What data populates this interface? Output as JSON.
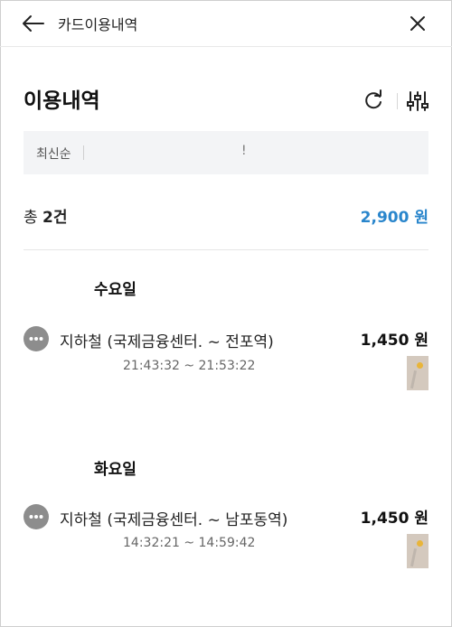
{
  "header": {
    "title": "카드이용내역",
    "back_icon": "arrow-left-icon",
    "close_icon": "close-icon"
  },
  "page": {
    "title": "이용내역",
    "refresh_icon": "refresh-icon",
    "filter_icon": "sliders-icon"
  },
  "sort": {
    "label": "최신순",
    "mark": "!"
  },
  "summary": {
    "count_prefix": "총",
    "count_value": "2건",
    "total_amount": "2,900 원"
  },
  "groups": [
    {
      "day": "수요일",
      "transactions": [
        {
          "title": "지하철 (국제금융센터.   ~ 전포역)",
          "time": "21:43:32 ~ 21:53:22",
          "amount": "1,450 원"
        }
      ]
    },
    {
      "day": "화요일",
      "transactions": [
        {
          "title": "지하철 (국제금융센터.   ~ 남포동역)",
          "time": "14:32:21 ~ 14:59:42",
          "amount": "1,450 원"
        }
      ]
    }
  ],
  "colors": {
    "accent": "#2a86cc",
    "more_button": "#8d8d8d",
    "sort_bar": "#f3f4f6"
  }
}
